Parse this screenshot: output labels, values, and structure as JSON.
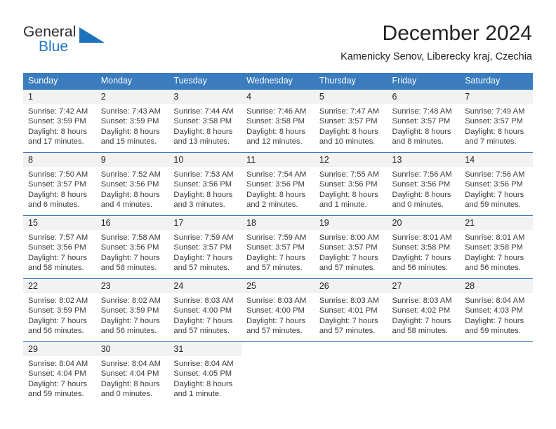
{
  "brand": {
    "word_top": "General",
    "word_bottom": "Blue",
    "accent_color": "#1d72bc",
    "logo_icon": "triangle-icon"
  },
  "header": {
    "title": "December 2024",
    "subtitle": "Kamenicky Senov, Liberecky kraj, Czechia"
  },
  "colors": {
    "header_band": "#3a7cbe",
    "day_number_band": "#f2f2f2",
    "text": "#222222"
  },
  "weekdays": [
    "Sunday",
    "Monday",
    "Tuesday",
    "Wednesday",
    "Thursday",
    "Friday",
    "Saturday"
  ],
  "weeks": [
    {
      "days": [
        {
          "number": "1",
          "sunrise": "Sunrise: 7:42 AM",
          "sunset": "Sunset: 3:59 PM",
          "daylight_line1": "Daylight: 8 hours",
          "daylight_line2": "and 17 minutes."
        },
        {
          "number": "2",
          "sunrise": "Sunrise: 7:43 AM",
          "sunset": "Sunset: 3:59 PM",
          "daylight_line1": "Daylight: 8 hours",
          "daylight_line2": "and 15 minutes."
        },
        {
          "number": "3",
          "sunrise": "Sunrise: 7:44 AM",
          "sunset": "Sunset: 3:58 PM",
          "daylight_line1": "Daylight: 8 hours",
          "daylight_line2": "and 13 minutes."
        },
        {
          "number": "4",
          "sunrise": "Sunrise: 7:46 AM",
          "sunset": "Sunset: 3:58 PM",
          "daylight_line1": "Daylight: 8 hours",
          "daylight_line2": "and 12 minutes."
        },
        {
          "number": "5",
          "sunrise": "Sunrise: 7:47 AM",
          "sunset": "Sunset: 3:57 PM",
          "daylight_line1": "Daylight: 8 hours",
          "daylight_line2": "and 10 minutes."
        },
        {
          "number": "6",
          "sunrise": "Sunrise: 7:48 AM",
          "sunset": "Sunset: 3:57 PM",
          "daylight_line1": "Daylight: 8 hours",
          "daylight_line2": "and 8 minutes."
        },
        {
          "number": "7",
          "sunrise": "Sunrise: 7:49 AM",
          "sunset": "Sunset: 3:57 PM",
          "daylight_line1": "Daylight: 8 hours",
          "daylight_line2": "and 7 minutes."
        }
      ]
    },
    {
      "days": [
        {
          "number": "8",
          "sunrise": "Sunrise: 7:50 AM",
          "sunset": "Sunset: 3:57 PM",
          "daylight_line1": "Daylight: 8 hours",
          "daylight_line2": "and 6 minutes."
        },
        {
          "number": "9",
          "sunrise": "Sunrise: 7:52 AM",
          "sunset": "Sunset: 3:56 PM",
          "daylight_line1": "Daylight: 8 hours",
          "daylight_line2": "and 4 minutes."
        },
        {
          "number": "10",
          "sunrise": "Sunrise: 7:53 AM",
          "sunset": "Sunset: 3:56 PM",
          "daylight_line1": "Daylight: 8 hours",
          "daylight_line2": "and 3 minutes."
        },
        {
          "number": "11",
          "sunrise": "Sunrise: 7:54 AM",
          "sunset": "Sunset: 3:56 PM",
          "daylight_line1": "Daylight: 8 hours",
          "daylight_line2": "and 2 minutes."
        },
        {
          "number": "12",
          "sunrise": "Sunrise: 7:55 AM",
          "sunset": "Sunset: 3:56 PM",
          "daylight_line1": "Daylight: 8 hours",
          "daylight_line2": "and 1 minute."
        },
        {
          "number": "13",
          "sunrise": "Sunrise: 7:56 AM",
          "sunset": "Sunset: 3:56 PM",
          "daylight_line1": "Daylight: 8 hours",
          "daylight_line2": "and 0 minutes."
        },
        {
          "number": "14",
          "sunrise": "Sunrise: 7:56 AM",
          "sunset": "Sunset: 3:56 PM",
          "daylight_line1": "Daylight: 7 hours",
          "daylight_line2": "and 59 minutes."
        }
      ]
    },
    {
      "days": [
        {
          "number": "15",
          "sunrise": "Sunrise: 7:57 AM",
          "sunset": "Sunset: 3:56 PM",
          "daylight_line1": "Daylight: 7 hours",
          "daylight_line2": "and 58 minutes."
        },
        {
          "number": "16",
          "sunrise": "Sunrise: 7:58 AM",
          "sunset": "Sunset: 3:56 PM",
          "daylight_line1": "Daylight: 7 hours",
          "daylight_line2": "and 58 minutes."
        },
        {
          "number": "17",
          "sunrise": "Sunrise: 7:59 AM",
          "sunset": "Sunset: 3:57 PM",
          "daylight_line1": "Daylight: 7 hours",
          "daylight_line2": "and 57 minutes."
        },
        {
          "number": "18",
          "sunrise": "Sunrise: 7:59 AM",
          "sunset": "Sunset: 3:57 PM",
          "daylight_line1": "Daylight: 7 hours",
          "daylight_line2": "and 57 minutes."
        },
        {
          "number": "19",
          "sunrise": "Sunrise: 8:00 AM",
          "sunset": "Sunset: 3:57 PM",
          "daylight_line1": "Daylight: 7 hours",
          "daylight_line2": "and 57 minutes."
        },
        {
          "number": "20",
          "sunrise": "Sunrise: 8:01 AM",
          "sunset": "Sunset: 3:58 PM",
          "daylight_line1": "Daylight: 7 hours",
          "daylight_line2": "and 56 minutes."
        },
        {
          "number": "21",
          "sunrise": "Sunrise: 8:01 AM",
          "sunset": "Sunset: 3:58 PM",
          "daylight_line1": "Daylight: 7 hours",
          "daylight_line2": "and 56 minutes."
        }
      ]
    },
    {
      "days": [
        {
          "number": "22",
          "sunrise": "Sunrise: 8:02 AM",
          "sunset": "Sunset: 3:59 PM",
          "daylight_line1": "Daylight: 7 hours",
          "daylight_line2": "and 56 minutes."
        },
        {
          "number": "23",
          "sunrise": "Sunrise: 8:02 AM",
          "sunset": "Sunset: 3:59 PM",
          "daylight_line1": "Daylight: 7 hours",
          "daylight_line2": "and 56 minutes."
        },
        {
          "number": "24",
          "sunrise": "Sunrise: 8:03 AM",
          "sunset": "Sunset: 4:00 PM",
          "daylight_line1": "Daylight: 7 hours",
          "daylight_line2": "and 57 minutes."
        },
        {
          "number": "25",
          "sunrise": "Sunrise: 8:03 AM",
          "sunset": "Sunset: 4:00 PM",
          "daylight_line1": "Daylight: 7 hours",
          "daylight_line2": "and 57 minutes."
        },
        {
          "number": "26",
          "sunrise": "Sunrise: 8:03 AM",
          "sunset": "Sunset: 4:01 PM",
          "daylight_line1": "Daylight: 7 hours",
          "daylight_line2": "and 57 minutes."
        },
        {
          "number": "27",
          "sunrise": "Sunrise: 8:03 AM",
          "sunset": "Sunset: 4:02 PM",
          "daylight_line1": "Daylight: 7 hours",
          "daylight_line2": "and 58 minutes."
        },
        {
          "number": "28",
          "sunrise": "Sunrise: 8:04 AM",
          "sunset": "Sunset: 4:03 PM",
          "daylight_line1": "Daylight: 7 hours",
          "daylight_line2": "and 59 minutes."
        }
      ]
    },
    {
      "days": [
        {
          "number": "29",
          "sunrise": "Sunrise: 8:04 AM",
          "sunset": "Sunset: 4:04 PM",
          "daylight_line1": "Daylight: 7 hours",
          "daylight_line2": "and 59 minutes."
        },
        {
          "number": "30",
          "sunrise": "Sunrise: 8:04 AM",
          "sunset": "Sunset: 4:04 PM",
          "daylight_line1": "Daylight: 8 hours",
          "daylight_line2": "and 0 minutes."
        },
        {
          "number": "31",
          "sunrise": "Sunrise: 8:04 AM",
          "sunset": "Sunset: 4:05 PM",
          "daylight_line1": "Daylight: 8 hours",
          "daylight_line2": "and 1 minute."
        },
        {
          "number": "",
          "sunrise": "",
          "sunset": "",
          "daylight_line1": "",
          "daylight_line2": ""
        },
        {
          "number": "",
          "sunrise": "",
          "sunset": "",
          "daylight_line1": "",
          "daylight_line2": ""
        },
        {
          "number": "",
          "sunrise": "",
          "sunset": "",
          "daylight_line1": "",
          "daylight_line2": ""
        },
        {
          "number": "",
          "sunrise": "",
          "sunset": "",
          "daylight_line1": "",
          "daylight_line2": ""
        }
      ]
    }
  ]
}
